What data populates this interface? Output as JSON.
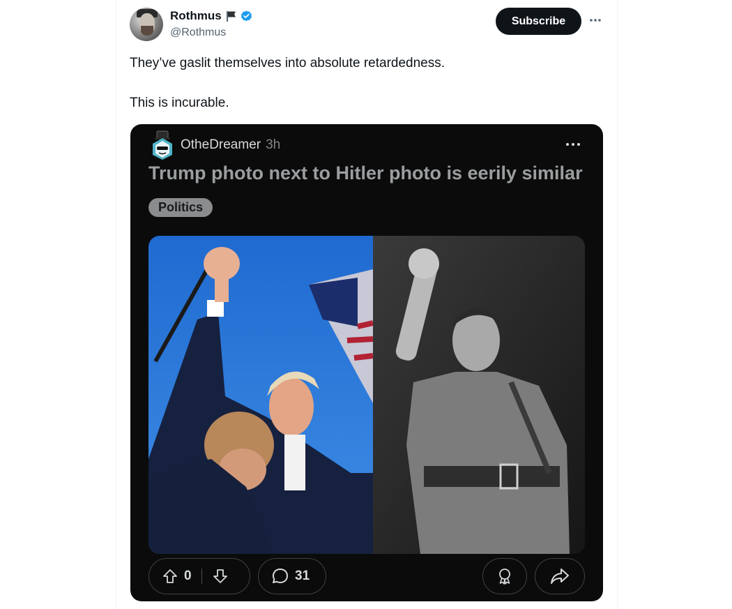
{
  "tweet": {
    "author": {
      "display_name": "Rothmus",
      "handle": "@Rothmus",
      "flag_icon": "black-flag-icon",
      "verified_icon": "verified-badge-icon",
      "verified_color": "#1d9bf0"
    },
    "subscribe_label": "Subscribe",
    "more_icon": "more-horizontal-icon",
    "text_lines": [
      "They’ve gaslit themselves into absolute retardedness.",
      "This is incurable."
    ]
  },
  "embedded_post": {
    "username": "OtheDreamer",
    "time": "3h",
    "title": "Trump photo next to Hitler photo is eerily similar",
    "flair": "Politics",
    "upvotes": "0",
    "comments": "31",
    "icons": {
      "upvote": "arrow-up-icon",
      "downvote": "arrow-down-icon",
      "comment": "comment-bubble-icon",
      "award": "award-icon",
      "share": "share-arrow-icon",
      "more": "more-horizontal-icon",
      "community": "community-avatar-icon"
    },
    "background_color": "#0b0b0b"
  }
}
